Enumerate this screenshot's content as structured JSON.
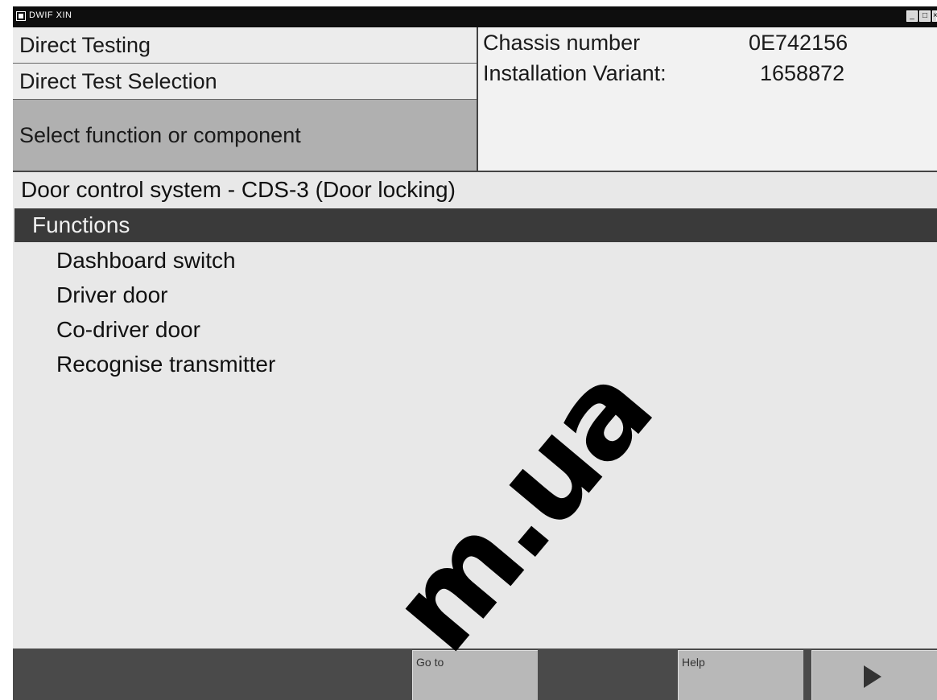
{
  "window": {
    "title": "DWIF XIN"
  },
  "header": {
    "line1": "Direct Testing",
    "line2": "Direct Test Selection",
    "line3": "Select function or component",
    "chassis_label": "Chassis number",
    "chassis_value": "0E742156",
    "variant_label": "Installation Variant:",
    "variant_value": "1658872"
  },
  "main": {
    "system_title": "Door control system - CDS-3 (Door locking)",
    "functions_header": "Functions",
    "items": [
      {
        "label": "Dashboard switch"
      },
      {
        "label": "Driver door"
      },
      {
        "label": "Co-driver door"
      },
      {
        "label": "Recognise transmitter"
      }
    ]
  },
  "footer": {
    "goto_label": "Go to",
    "help_label": "Help"
  },
  "watermark": {
    "text": "m.ua"
  },
  "colors": {
    "titlebar": "#0e0e0e",
    "panel": "#e8e8e8",
    "selected_header": "#3a3a3a",
    "footer": "#4a4a4a",
    "button": "#b8b8b8"
  }
}
